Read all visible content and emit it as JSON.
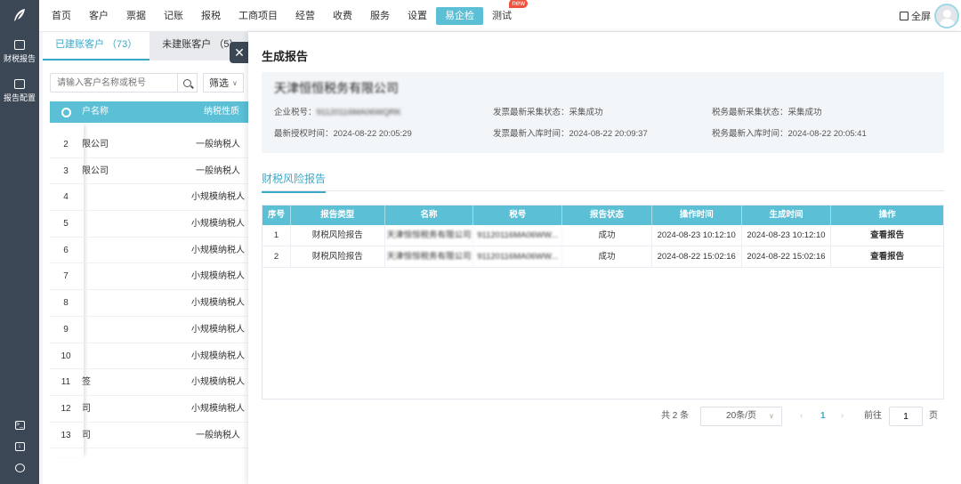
{
  "nav": {
    "items": [
      "首页",
      "客户",
      "票据",
      "记账",
      "报税",
      "工商项目",
      "经营",
      "收费",
      "服务",
      "设置",
      "易企检",
      "测试"
    ],
    "active_index": 10,
    "new_badge": "new",
    "fullscreen_label": "全屏"
  },
  "sidebar": {
    "items": [
      {
        "label": "财税报告",
        "icon": "chart-icon"
      },
      {
        "label": "报告配置",
        "icon": "gear-icon"
      }
    ],
    "bottom_icons": [
      "terminal-icon",
      "download-icon",
      "support-icon"
    ]
  },
  "customers": {
    "tabs": [
      {
        "label": "已建账客户 （73）"
      },
      {
        "label": "未建账客户 （5）"
      }
    ],
    "search_placeholder": "请输入客户名称或税号",
    "filter_label": "筛选",
    "columns": [
      "户名称",
      "纳税性质"
    ],
    "rows": [
      {
        "n": "2",
        "name": "限公司",
        "type": "一般纳税人"
      },
      {
        "n": "3",
        "name": "限公司",
        "type": "一般纳税人"
      },
      {
        "n": "4",
        "name": "",
        "type": "小规模纳税人"
      },
      {
        "n": "5",
        "name": "",
        "type": "小规模纳税人"
      },
      {
        "n": "6",
        "name": "",
        "type": "小规模纳税人"
      },
      {
        "n": "7",
        "name": "",
        "type": "小规模纳税人"
      },
      {
        "n": "8",
        "name": "",
        "type": "小规模纳税人"
      },
      {
        "n": "9",
        "name": "",
        "type": "小规模纳税人"
      },
      {
        "n": "10",
        "name": "",
        "type": "小规模纳税人"
      },
      {
        "n": "11",
        "name": "签",
        "type": "小规模纳税人"
      },
      {
        "n": "12",
        "name": "司",
        "type": "小规模纳税人"
      },
      {
        "n": "13",
        "name": "司",
        "type": "一般纳税人"
      }
    ]
  },
  "drawer": {
    "title": "生成报告",
    "company_name": "天津恒恒税务有限公司",
    "info": {
      "tax_id_label": "企业税号：",
      "tax_id_value": "91120116MA06WQRK",
      "invoice_collect_label": "发票最新采集状态：",
      "invoice_collect_value": "采集成功",
      "tax_collect_label": "税务最新采集状态：",
      "tax_collect_value": "采集成功",
      "auth_time_label": "最新授权时间：",
      "auth_time_value": "2024-08-22 20:05:29",
      "invoice_store_label": "发票最新入库时间：",
      "invoice_store_value": "2024-08-22 20:09:37",
      "tax_store_label": "税务最新入库时间：",
      "tax_store_value": "2024-08-22 20:05:41"
    },
    "section_tab": "财税风险报告",
    "table": {
      "columns": [
        "序号",
        "报告类型",
        "名称",
        "税号",
        "报告状态",
        "操作时间",
        "生成时间",
        "操作"
      ],
      "rows": [
        {
          "n": "1",
          "type": "财税风险报告",
          "name": "天津恒恒税务有限公司",
          "tax_id": "91120116MA06WW...",
          "status": "成功",
          "op_time": "2024-08-23 10:12:10",
          "gen_time": "2024-08-23 10:12:10",
          "action": "查看报告"
        },
        {
          "n": "2",
          "type": "财税风险报告",
          "name": "天津恒恒税务有限公司",
          "tax_id": "91120116MA06WW...",
          "status": "成功",
          "op_time": "2024-08-22 15:02:16",
          "gen_time": "2024-08-22 15:02:16",
          "action": "查看报告"
        }
      ]
    },
    "pagination": {
      "total": "共 2 条",
      "page_size": "20条/页",
      "current_page": "1",
      "goto_label": "前往",
      "goto_value": "1",
      "goto_unit": "页"
    }
  }
}
